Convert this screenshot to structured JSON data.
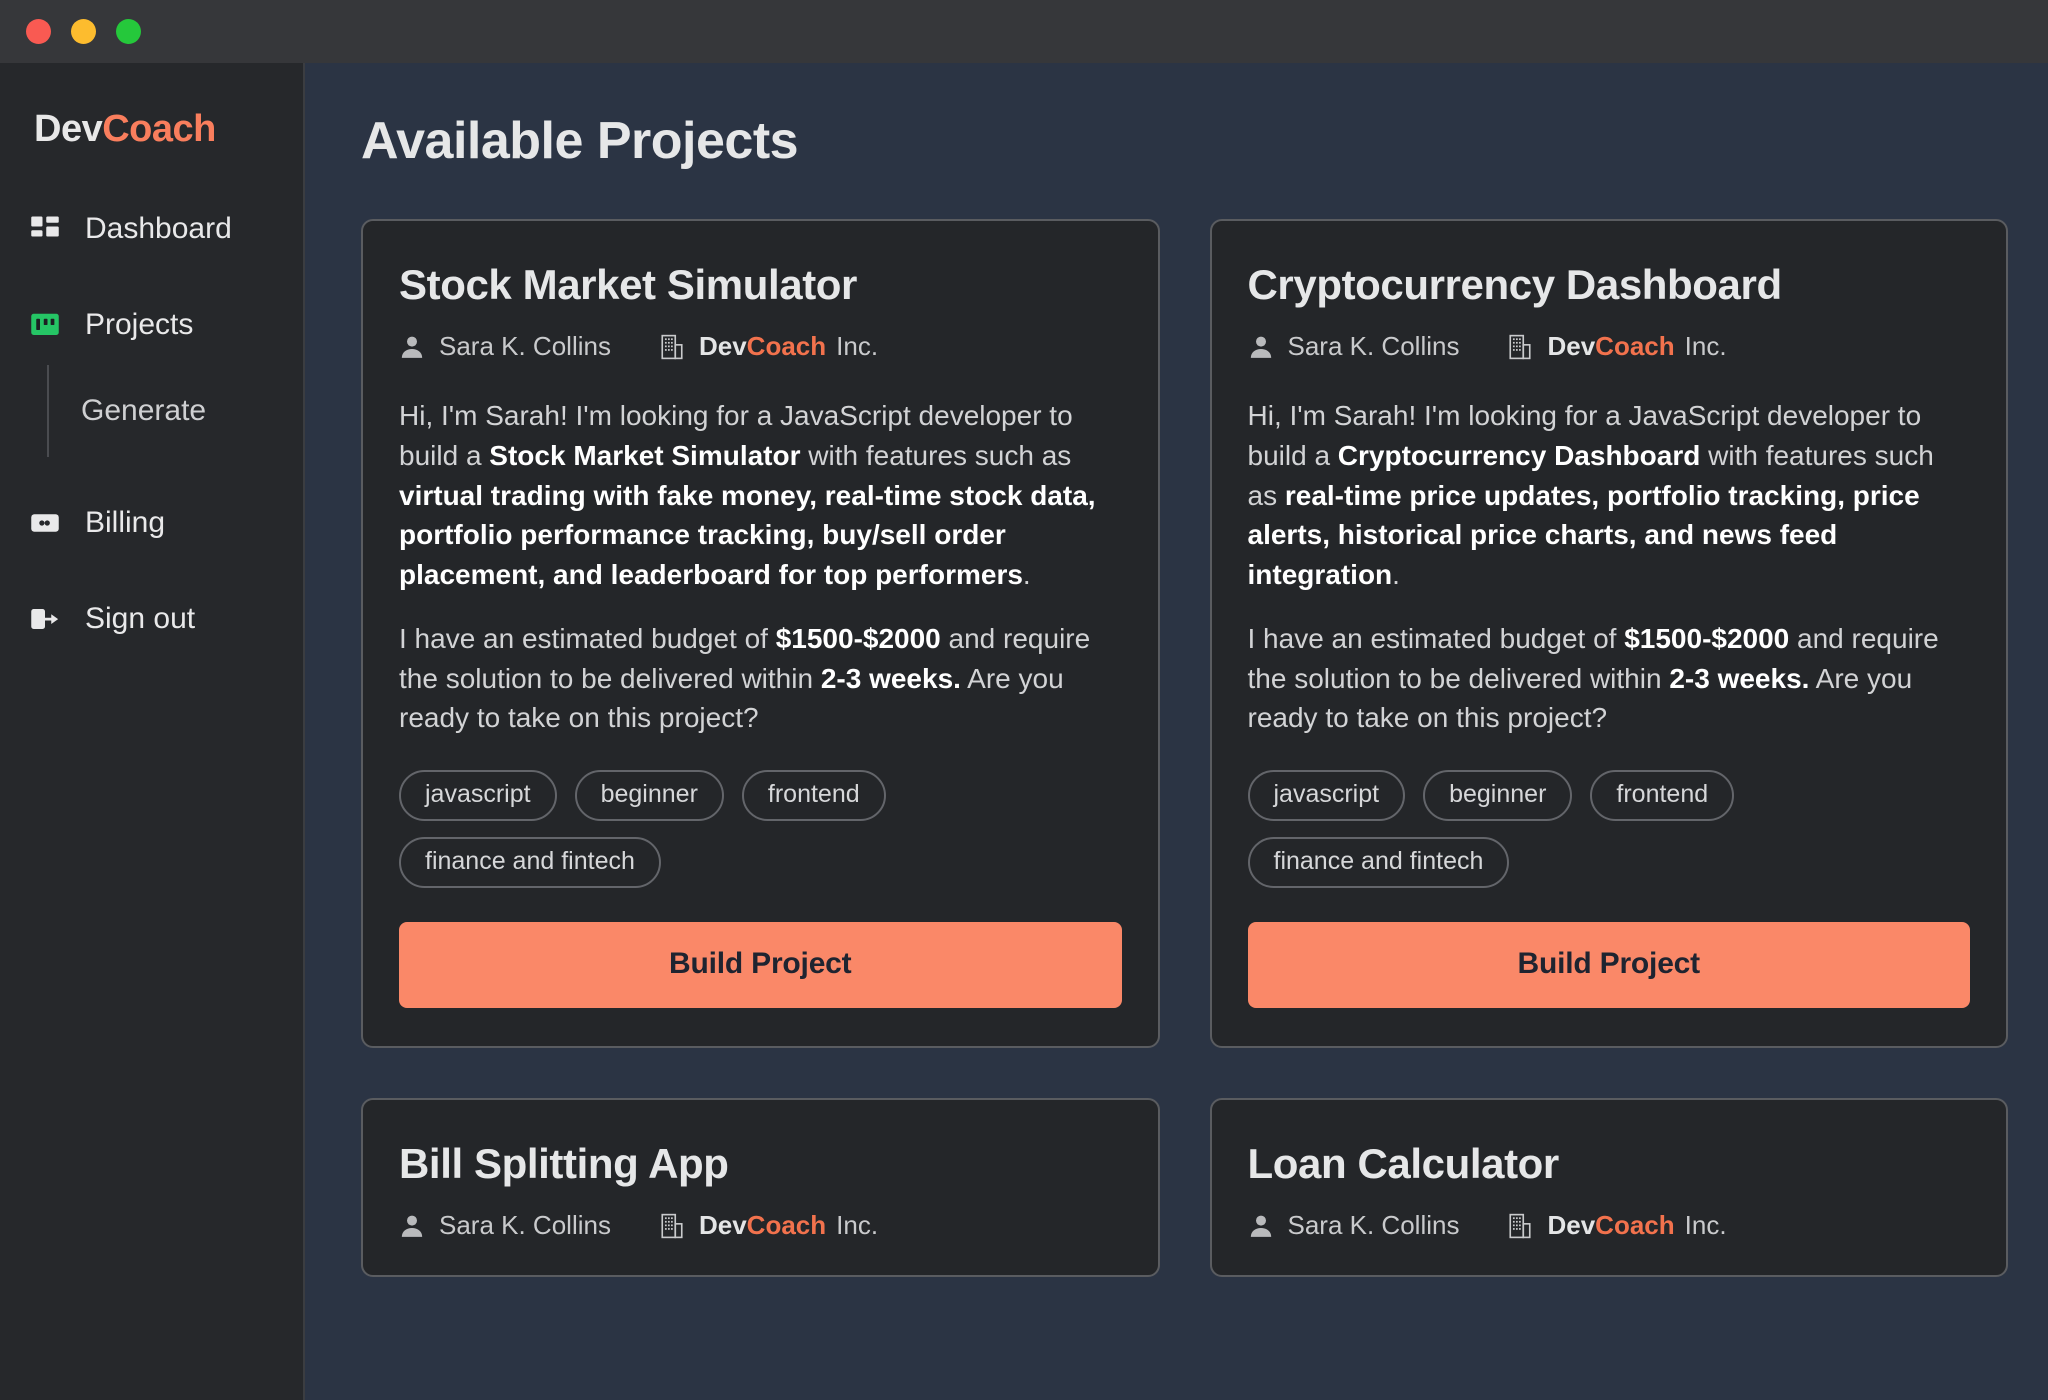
{
  "window": {
    "traffic_lights": [
      "close",
      "minimize",
      "maximize"
    ],
    "colors": {
      "accent": "#f97e5d",
      "button": "#fa8868",
      "projects_icon": "#25c565",
      "main_bg": "#2b3444",
      "card_bg": "#242629",
      "sidebar_bg": "#26282b",
      "titlebar_bg": "#36373a",
      "dot_red": "#f95a52",
      "dot_yellow": "#fdbc2e",
      "dot_green": "#25c83b"
    }
  },
  "sidebar": {
    "brand": {
      "first": "Dev",
      "second": "Coach"
    },
    "items": [
      {
        "label": "Dashboard",
        "icon": "grid-icon"
      },
      {
        "label": "Projects",
        "icon": "board-icon"
      },
      {
        "label": "Billing",
        "icon": "credit-card-icon"
      },
      {
        "label": "Sign out",
        "icon": "sign-out-icon"
      }
    ],
    "subitems": [
      {
        "label": "Generate"
      }
    ]
  },
  "header": {
    "title": "Available Projects"
  },
  "meta_defaults": {
    "author": "Sara K. Collins",
    "company_first": "Dev",
    "company_second": "Coach",
    "company_suffix": "Inc.",
    "person_icon": "person-icon",
    "building_icon": "building-icon"
  },
  "cards": [
    {
      "title": "Stock Market Simulator",
      "author": "Sara K. Collins",
      "company_first": "Dev",
      "company_second": "Coach",
      "company_suffix": "Inc.",
      "paragraph1_pre": "Hi, I'm Sarah! I'm looking for a JavaScript developer to build a ",
      "paragraph1_strong1": "Stock Market Simulator",
      "paragraph1_mid": " with features such as ",
      "paragraph1_strong2": "virtual trading with fake money, real-time stock data, portfolio performance tracking, buy/sell order placement, and leaderboard for top performers",
      "paragraph1_post": ".",
      "paragraph2_pre": "I have an estimated budget of ",
      "budget": "$1500-$2000",
      "paragraph2_mid": " and require the solution to be delivered within ",
      "duration": "2-3 weeks.",
      "paragraph2_post": " Are you ready to take on this project?",
      "tags": [
        "javascript",
        "beginner",
        "frontend",
        "finance and fintech"
      ],
      "button_label": "Build Project"
    },
    {
      "title": "Cryptocurrency Dashboard",
      "author": "Sara K. Collins",
      "company_first": "Dev",
      "company_second": "Coach",
      "company_suffix": "Inc.",
      "paragraph1_pre": "Hi, I'm Sarah! I'm looking for a JavaScript developer to build a ",
      "paragraph1_strong1": "Cryptocurrency Dashboard",
      "paragraph1_mid": " with features such as ",
      "paragraph1_strong2": "real-time price updates, portfolio tracking, price alerts, historical price charts, and news feed integration",
      "paragraph1_post": ".",
      "paragraph2_pre": "I have an estimated budget of ",
      "budget": "$1500-$2000",
      "paragraph2_mid": " and require the solution to be delivered within ",
      "duration": "2-3 weeks.",
      "paragraph2_post": " Are you ready to take on this project?",
      "tags": [
        "javascript",
        "beginner",
        "frontend",
        "finance and fintech"
      ],
      "button_label": "Build Project"
    },
    {
      "title": "Bill Splitting App",
      "author": "Sara K. Collins",
      "company_first": "Dev",
      "company_second": "Coach",
      "company_suffix": "Inc."
    },
    {
      "title": "Loan Calculator",
      "author": "Sara K. Collins",
      "company_first": "Dev",
      "company_second": "Coach",
      "company_suffix": "Inc."
    }
  ]
}
